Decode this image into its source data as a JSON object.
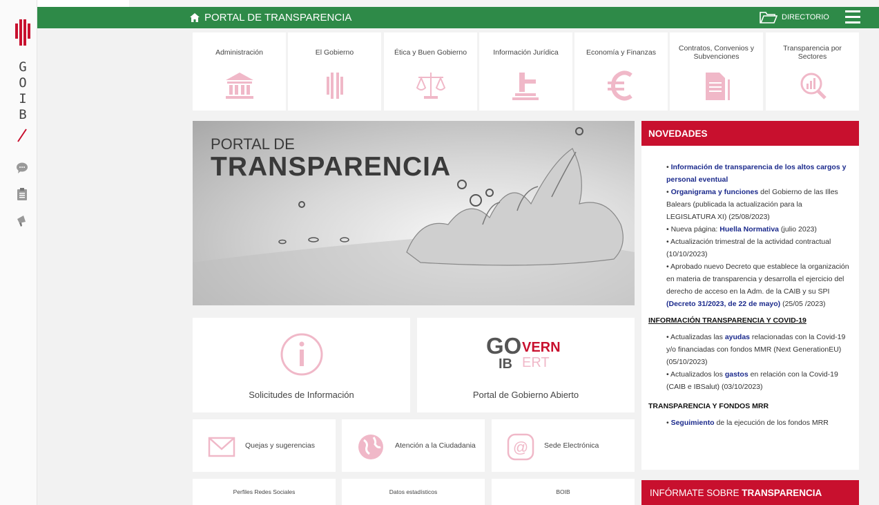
{
  "header": {
    "title": "PORTAL DE TRANSPARENCIA",
    "directory": "DIRECTORIO"
  },
  "sidebar": {
    "brand_letters": [
      "G",
      "O",
      "I",
      "B"
    ]
  },
  "categories": [
    {
      "label": "Administración",
      "icon": "institution-icon"
    },
    {
      "label": "El Gobierno",
      "icon": "government-emblem-icon"
    },
    {
      "label": "Ética y Buen Gobierno",
      "icon": "scales-icon"
    },
    {
      "label": "Información Jurídica",
      "icon": "gavel-icon"
    },
    {
      "label": "Economía y Finanzas",
      "icon": "euro-icon"
    },
    {
      "label": "Contratos, Convenios y Subvenciones",
      "icon": "document-icon"
    },
    {
      "label": "Transparencia por Sectores",
      "icon": "magnifier-chart-icon"
    }
  ],
  "hero": {
    "subtitle": "PORTAL DE",
    "title": "TRANSPARENCIA"
  },
  "boxes": {
    "requests": "Solicitudes de Información",
    "open_gov": "Portal de Gobierno Abierto",
    "govern_logo": {
      "go": "GO",
      "vern": "VERN",
      "ib": "IB",
      "ert": "ERT"
    },
    "complaints": "Quejas y sugerencias",
    "citizen": "Atención a la Ciudadania",
    "sede": "Sede Electrónica",
    "social": "Perfiles Redes Sociales",
    "stats": "Datos estadísticos",
    "boib": "BOIB"
  },
  "news": {
    "title": "NOVEDADES",
    "items": [
      {
        "bold": "Información de transparencia de los altos cargos y personal eventual",
        "rest": ""
      },
      {
        "bold": "Organigrama y funciones",
        "rest": " del Gobierno de las Illes Balears (publicada la actualización para la LEGISLATURA XI) (25/08/2023)"
      },
      {
        "pre": "Nueva página: ",
        "bold": "Huella Normativa",
        "rest": " (julio 2023)"
      },
      {
        "pre": "Actualización trimestral de la actividad contractual (10/10/2023)"
      },
      {
        "pre": "Aprobado nuevo Decreto que establece la organización en materia de transparencia y desarrolla el ejercicio del derecho de acceso en la Adm. de la CAIB y su SPI ",
        "bold": "(Decreto 31/2023, de 22 de mayo)",
        "rest": " (25/05 /2023)"
      }
    ],
    "covid_title": "INFORMACIÓN TRANSPARENCIA Y COVID-19",
    "covid_items": [
      {
        "pre": "Actualizadas las ",
        "bold": "ayudas",
        "rest": " relacionadas con la Covid-19 y/o financiadas con fondos MMR (Next GenerationEU) (05/10/2023)"
      },
      {
        "pre": "Actualizados los ",
        "bold": "gastos",
        "rest": " en relación con la Covid-19 (CAIB e IBSalut) (03/10/2023)"
      }
    ],
    "mrr_title": "TRANSPARENCIA Y FONDOS MRR",
    "mrr_items": [
      {
        "bold": "Seguimiento",
        "rest": " de la ejecución de los fondos MRR"
      }
    ]
  },
  "informate": {
    "pre": "INFÓRMATE SOBRE ",
    "bold": "TRANSPARENCIA"
  },
  "colors": {
    "green": "#2e8a48",
    "red": "#c8102e",
    "pink": "#f0b8c8",
    "link": "#1b2a8c"
  }
}
